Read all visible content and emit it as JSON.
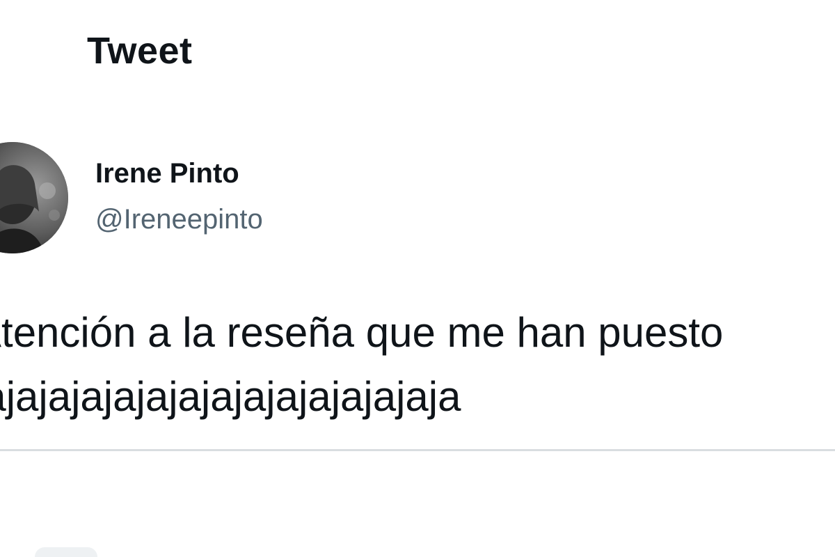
{
  "header": {
    "title": "Tweet"
  },
  "tweet": {
    "author": {
      "name": "Irene Pinto",
      "handle": "@Ireneepinto",
      "avatar_icon": "profile-photo"
    },
    "text_lines": [
      "Atención a la reseña que me han puesto",
      "jajajajajajajajajajajajajajaja"
    ]
  },
  "colors": {
    "text_primary": "#0f1419",
    "text_secondary": "#536471",
    "divider": "#d9dde0",
    "background": "#ffffff"
  }
}
